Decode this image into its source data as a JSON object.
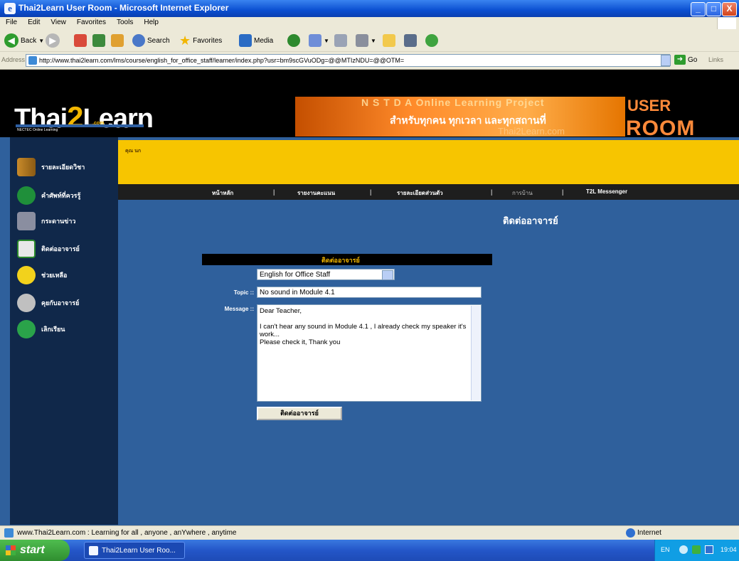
{
  "window": {
    "title": "Thai2Learn User Room - Microsoft Internet Explorer",
    "buttons": [
      "_",
      "□",
      "X"
    ]
  },
  "menu": [
    "File",
    "Edit",
    "View",
    "Favorites",
    "Tools",
    "Help"
  ],
  "toolbar": {
    "back": "Back",
    "search": "Search",
    "favorites": "Favorites",
    "media": "Media"
  },
  "address": {
    "label": "Address",
    "url": "http://www.thai2learn.com/lms/course/english_for_office_staff/learner/index.php?usr=bm9scGVuODg=@@MTIzNDU=@@OTM=",
    "go": "Go",
    "links": "Links"
  },
  "banner": {
    "logo_a": "Th",
    "logo_b": "ai",
    "logo_c": "2",
    "logo_d": "Learn",
    "logo_dotcom": ".com",
    "tagline": "NECTEC Online Learning",
    "eng_text": "N S T D A  Online Learning Project",
    "thai_text": "สำหรับทุกคน ทุกเวลา และทุกสถานที่",
    "url_text": "Thai2Learn.com",
    "user": "USER",
    "room": "ROOM"
  },
  "sidebar": {
    "items": [
      {
        "label": "รายละเอียดวิชา",
        "icon": "books-icon"
      },
      {
        "label": "คำศัพท์ที่ควรรู้",
        "icon": "book-icon"
      },
      {
        "label": "กระดานข่าว",
        "icon": "bulletin-icon"
      },
      {
        "label": "ติดต่ออาจารย์",
        "icon": "monitor-icon"
      },
      {
        "label": "ช่วยเหลือ",
        "icon": "help-bulb-icon"
      },
      {
        "label": "คุยกับอาจารย์",
        "icon": "chat-person-icon"
      },
      {
        "label": "เลิกเรียน",
        "icon": "exit-globe-icon"
      }
    ]
  },
  "greeting": "คุณ นก",
  "nav": {
    "items": [
      "หน้าหลัก",
      "รายงานคะแนน",
      "รายละเอียดส่วนตัว",
      "การบ้าน",
      "T2L Messenger"
    ]
  },
  "contact": {
    "title": "ติดต่ออาจารย์",
    "form_header": "ติดต่ออาจารย์",
    "course_value": "English for Office Staff",
    "topic_label": "Topic ::",
    "topic_value": "No sound in Module 4.1",
    "message_label": "Message ::",
    "message_value": "Dear Teacher,\n\nI can't hear any sound in Module 4.1 , I already check my speaker it's work...\nPlease check it, Thank you",
    "submit_label": "ติดต่ออาจารย์"
  },
  "status": {
    "text": "www.Thai2Learn.com : Learning for all , anyone , anYwhere , anytime",
    "zone": "Internet"
  },
  "taskbar": {
    "start": "start",
    "task": "Thai2Learn User Roo...",
    "lang": "EN",
    "clock": "19:04"
  }
}
